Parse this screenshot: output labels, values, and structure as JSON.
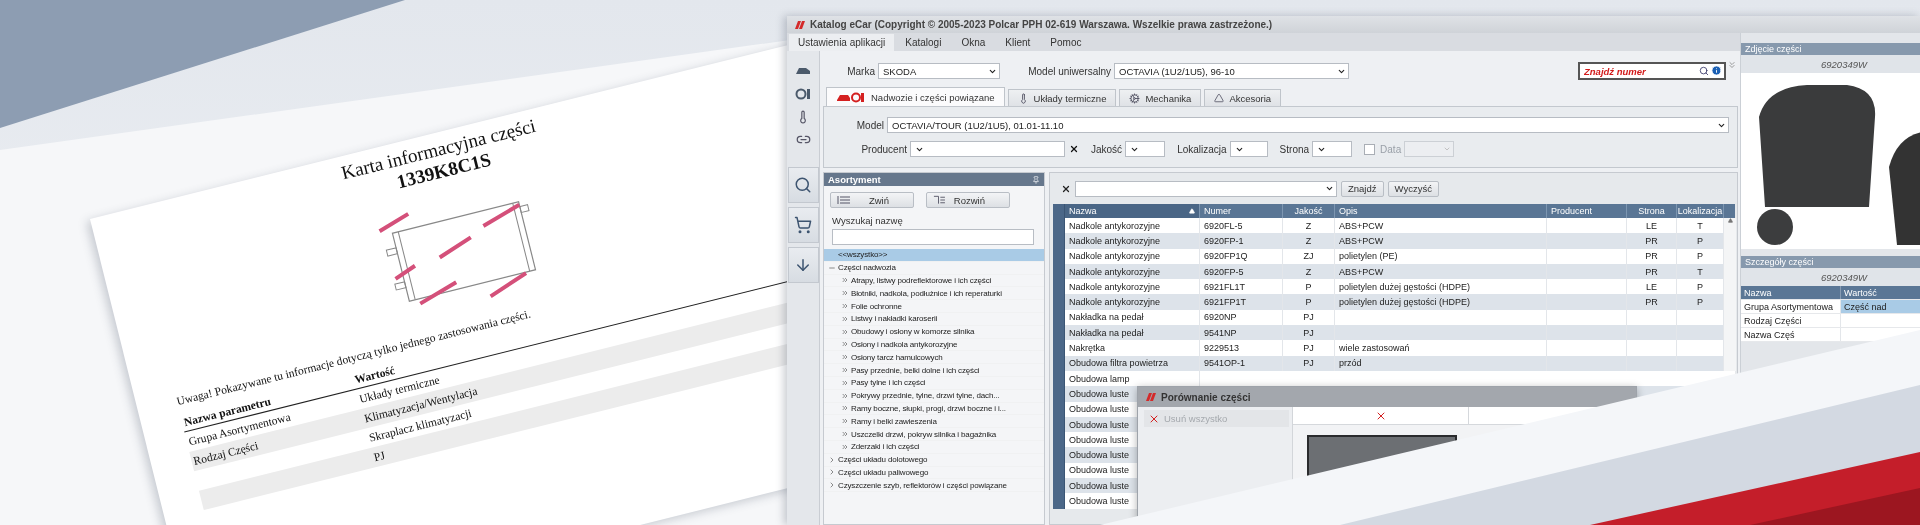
{
  "info_card": {
    "title": "Karta informacyjna części",
    "code": "1339K8C1S",
    "note": "Uwaga! Pokazywane tu informacje dotyczą tylko jednego zastosowania części.",
    "columns": [
      "Nazwa parametru",
      "Wartość"
    ],
    "rows": [
      {
        "name": "Grupa Asortymentowa",
        "value": "Układy termiczne"
      },
      {
        "name": "Rodzaj Części",
        "value": "Klimatyzacja/Wentylacja"
      },
      {
        "value": "Skraplacz klimatyzacji"
      },
      {
        "value": "PJ"
      }
    ]
  },
  "window": {
    "title": "Katalog eCar (Copyright © 2005-2023 Polcar PPH 02-619 Warszawa. Wszelkie prawa zastrzeżone.)"
  },
  "menu": [
    {
      "label": "Ustawienia aplikacji",
      "selected": true
    },
    {
      "label": "Katalogi",
      "selected": false
    },
    {
      "label": "Okna",
      "selected": false
    },
    {
      "label": "Klient",
      "selected": false
    },
    {
      "label": "Pomoc",
      "selected": false
    }
  ],
  "vehicle": {
    "make_label": "Marka",
    "make": "SKODA",
    "model_label": "Model uniwersalny",
    "model": "OCTAVIA (1U2/1U5), 96-10"
  },
  "number_search": {
    "placeholder": "Znajdź numer"
  },
  "tabs": [
    {
      "label": "Nadwozie i części powiązane",
      "selected": true
    },
    {
      "label": "Układy termiczne",
      "selected": false
    },
    {
      "label": "Mechanika",
      "selected": false
    },
    {
      "label": "Akcesoria",
      "selected": false
    }
  ],
  "filters": {
    "model_label": "Model",
    "model": "OCTAVIA/TOUR (1U2/1U5), 01.01-11.10",
    "producer_label": "Producent",
    "quality_label": "Jakość",
    "location_label": "Lokalizacja",
    "side_label": "Strona",
    "date_label": "Data",
    "date_checked": false,
    "date_disabled": true
  },
  "assortment": {
    "title": "Asortyment",
    "collapse_button": "Zwiń",
    "expand_button": "Rozwiń",
    "search_label": "Wyszukaj nazwę",
    "tree": [
      {
        "label": "<<wszystko>>",
        "kind": "all",
        "selected": true,
        "expanded": false
      },
      {
        "label": "Części nadwozia",
        "kind": "group",
        "selected": false,
        "expanded": true,
        "children": [
          {
            "label": "Atrapy, listwy podreflektorowe i ich części",
            "selected": false,
            "expanded": false
          },
          {
            "label": "Błotniki, nadkola, podłużnice i ich reperaturki",
            "selected": false,
            "expanded": false
          },
          {
            "label": "Folie ochronne",
            "selected": false,
            "expanded": false
          },
          {
            "label": "Listwy i nakładki karoserii",
            "selected": false,
            "expanded": false
          },
          {
            "label": "Obudowy i osłony w komorze silnika",
            "selected": false,
            "expanded": false
          },
          {
            "label": "Osłony i nadkola antykorozyjne",
            "selected": false,
            "expanded": false
          },
          {
            "label": "Osłony tarcz hamulcowych",
            "selected": false,
            "expanded": false
          },
          {
            "label": "Pasy przednie, belki dolne i ich części",
            "selected": false,
            "expanded": false
          },
          {
            "label": "Pasy tylne i ich części",
            "selected": false,
            "expanded": false
          },
          {
            "label": "Pokrywy przednie, tylne, drzwi tylne, dach...",
            "selected": false,
            "expanded": false
          },
          {
            "label": "Ramy boczne, słupki, progi, drzwi boczne i i...",
            "selected": false,
            "expanded": false
          },
          {
            "label": "Ramy i belki zawieszenia",
            "selected": false,
            "expanded": false
          },
          {
            "label": "Uszczelki drzwi, pokryw silnika i bagażnika",
            "selected": false,
            "expanded": false
          },
          {
            "label": "Zderzaki i ich części",
            "selected": false,
            "expanded": false
          }
        ]
      },
      {
        "label": "Części układu dolotowego",
        "kind": "group",
        "selected": false,
        "expanded": false
      },
      {
        "label": "Części układu paliwowego",
        "kind": "group",
        "selected": false,
        "expanded": false
      },
      {
        "label": "Czyszczenie szyb, reflektorów i części powiązane",
        "kind": "group",
        "selected": false,
        "expanded": false
      }
    ]
  },
  "results": {
    "find_button": "Znajdź",
    "clear_button": "Wyczyść",
    "columns": [
      {
        "label": "Nazwa",
        "sorted": true
      },
      {
        "label": "Numer",
        "sorted": false
      },
      {
        "label": "Jakość",
        "sorted": false
      },
      {
        "label": "Opis",
        "sorted": false
      },
      {
        "label": "Producent",
        "sorted": false
      },
      {
        "label": "Strona",
        "sorted": false
      },
      {
        "label": "Lokalizacja",
        "sorted": false
      }
    ],
    "rows": [
      {
        "cells": [
          "Nadkole antykorozyjne",
          "6920FL-5",
          "Z",
          "ABS+PCW",
          "",
          "LE",
          "T"
        ]
      },
      {
        "cells": [
          "Nadkole antykorozyjne",
          "6920FP-1",
          "Z",
          "ABS+PCW",
          "",
          "PR",
          "P"
        ]
      },
      {
        "cells": [
          "Nadkole antykorozyjne",
          "6920FP1Q",
          "ZJ",
          "polietylen (PE)",
          "",
          "PR",
          "P"
        ]
      },
      {
        "cells": [
          "Nadkole antykorozyjne",
          "6920FP-5",
          "Z",
          "ABS+PCW",
          "",
          "PR",
          "T"
        ]
      },
      {
        "cells": [
          "Nadkole antykorozyjne",
          "6921FL1T",
          "P",
          "polietylen dużej gęstości (HDPE)",
          "",
          "LE",
          "P"
        ]
      },
      {
        "cells": [
          "Nadkole antykorozyjne",
          "6921FP1T",
          "P",
          "polietylen dużej gęstości (HDPE)",
          "",
          "PR",
          "P"
        ]
      },
      {
        "cells": [
          "Nakładka na pedał",
          "6920NP",
          "PJ",
          "",
          "",
          "",
          ""
        ]
      },
      {
        "cells": [
          "Nakładka na pedał",
          "9541NP",
          "PJ",
          "",
          "",
          "",
          ""
        ]
      },
      {
        "cells": [
          "Nakrętka",
          "9229513",
          "PJ",
          "wiele zastosowań",
          "",
          "",
          ""
        ]
      },
      {
        "cells": [
          "Obudowa filtra powietrza",
          "9541OP-1",
          "PJ",
          "przód",
          "",
          "",
          ""
        ]
      },
      {
        "cells": [
          "Obudowa lamp"
        ]
      },
      {
        "cells": [
          "Obudowa luste"
        ]
      },
      {
        "cells": [
          "Obudowa luste"
        ]
      },
      {
        "cells": [
          "Obudowa luste"
        ]
      },
      {
        "cells": [
          "Obudowa luste"
        ]
      },
      {
        "cells": [
          "Obudowa luste"
        ]
      },
      {
        "cells": [
          "Obudowa luste"
        ]
      },
      {
        "cells": [
          "Obudowa luste"
        ]
      },
      {
        "cells": [
          "Obudowa luste"
        ]
      }
    ]
  },
  "compare_dialog": {
    "title": "Porównanie części",
    "remove_all_button": "Usuń wszystko",
    "remove_all_disabled": true
  },
  "part_photo": {
    "title": "Zdjęcie części",
    "number": "6920349W"
  },
  "part_details": {
    "title": "Szczegóły części",
    "number": "6920349W",
    "columns": [
      "Nazwa",
      "Wartość"
    ],
    "rows": [
      {
        "name": "Grupa Asortymentowa",
        "value": "Część nad",
        "selected": true
      },
      {
        "name": "Rodzaj Części",
        "value": "",
        "selected": false
      },
      {
        "name": "Nazwa Częś",
        "value": "",
        "selected": false
      }
    ]
  }
}
